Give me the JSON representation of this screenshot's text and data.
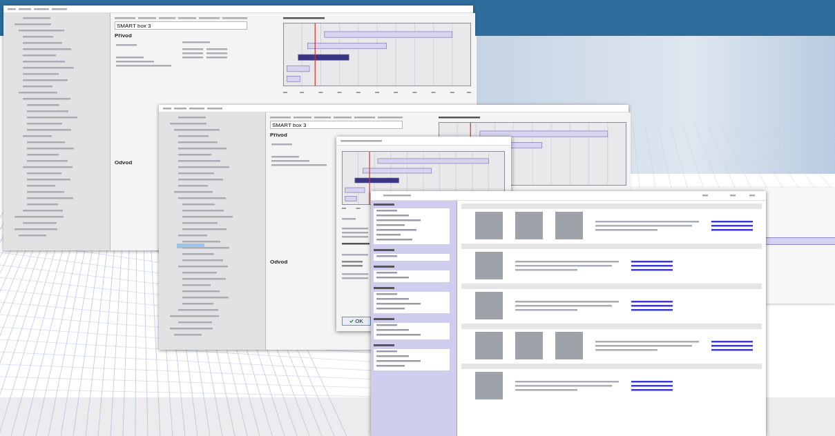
{
  "windows": [
    {
      "kind": "calculator",
      "field": {
        "value": "SMART box 3"
      },
      "headings": [
        "Přívod",
        "Odvod"
      ],
      "tree_selected": false
    },
    {
      "kind": "calculator",
      "field": {
        "value": "SMART box 3"
      },
      "headings": [
        "Přívod",
        "Odvod"
      ],
      "tree_selected": true
    },
    {
      "kind": "chart_dialog",
      "button": "OK"
    },
    {
      "kind": "catalog"
    }
  ]
}
